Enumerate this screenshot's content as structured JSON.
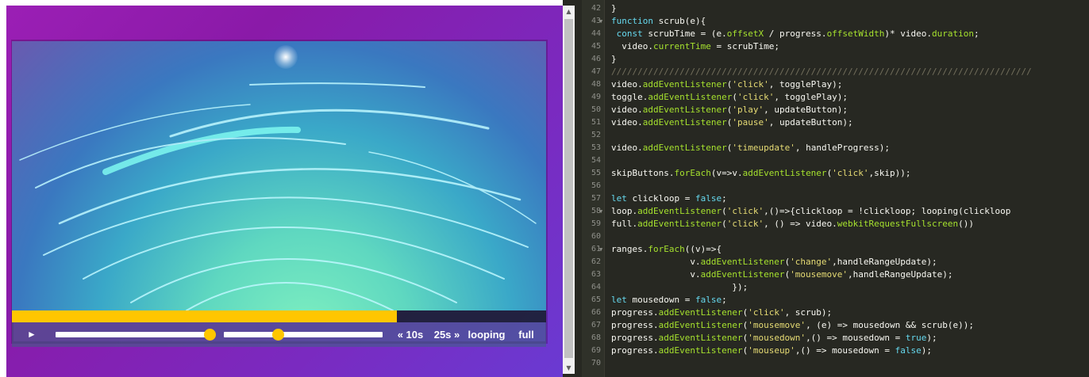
{
  "controls": {
    "play_icon": "►",
    "skip_back": "« 10s",
    "skip_forward": "25s »",
    "looping": "looping",
    "full": "full",
    "volume": 0.97,
    "playback_rate": 0.34,
    "progress": 0.72
  },
  "editor": {
    "lines": [
      {
        "n": "42",
        "text": "}"
      },
      {
        "n": "43",
        "fold": true,
        "text": "function scrub(e){"
      },
      {
        "n": "44",
        "text": " const scrubTime = (e.offsetX / progress.offsetWidth)* video.duration;"
      },
      {
        "n": "45",
        "text": "  video.currentTime = scrubTime;"
      },
      {
        "n": "46",
        "text": "}"
      },
      {
        "n": "47",
        "text": "////////////////////////////////////////////////////////////////////////////////"
      },
      {
        "n": "48",
        "text": "video.addEventListener('click', togglePlay);"
      },
      {
        "n": "49",
        "text": "toggle.addEventListener('click', togglePlay);"
      },
      {
        "n": "50",
        "text": "video.addEventListener('play', updateButton);"
      },
      {
        "n": "51",
        "text": "video.addEventListener('pause', updateButton);"
      },
      {
        "n": "52",
        "text": ""
      },
      {
        "n": "53",
        "text": "video.addEventListener('timeupdate', handleProgress);"
      },
      {
        "n": "54",
        "text": ""
      },
      {
        "n": "55",
        "text": "skipButtons.forEach(v=>v.addEventListener('click',skip));"
      },
      {
        "n": "56",
        "text": ""
      },
      {
        "n": "57",
        "text": "let clickloop = false;"
      },
      {
        "n": "58",
        "fold": true,
        "text": "loop.addEventListener('click',()=>{clickloop = !clickloop; looping(clickloop"
      },
      {
        "n": "59",
        "text": "full.addEventListener('click', () => video.webkitRequestFullscreen())"
      },
      {
        "n": "60",
        "text": ""
      },
      {
        "n": "61",
        "fold": true,
        "text": "ranges.forEach((v)=>{"
      },
      {
        "n": "62",
        "text": "               v.addEventListener('change',handleRangeUpdate);"
      },
      {
        "n": "63",
        "text": "               v.addEventListener('mousemove',handleRangeUpdate);"
      },
      {
        "n": "64",
        "text": "                       });"
      },
      {
        "n": "65",
        "text": "let mousedown = false;"
      },
      {
        "n": "66",
        "text": "progress.addEventListener('click', scrub);"
      },
      {
        "n": "67",
        "text": "progress.addEventListener('mousemove', (e) => mousedown && scrub(e));"
      },
      {
        "n": "68",
        "text": "progress.addEventListener('mousedown',() => mousedown = true);"
      },
      {
        "n": "69",
        "text": "progress.addEventListener('mouseup',() => mousedown = false);"
      },
      {
        "n": "70",
        "text": ""
      }
    ]
  }
}
